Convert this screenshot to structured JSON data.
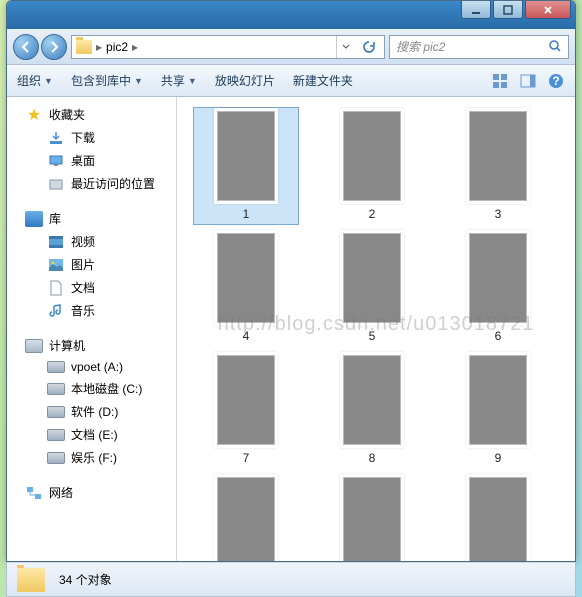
{
  "title": "",
  "path": {
    "folder": "pic2",
    "sep": "▸"
  },
  "search": {
    "placeholder": "搜索 pic2"
  },
  "toolbar": {
    "organize": "组织",
    "include": "包含到库中",
    "share": "共享",
    "slideshow": "放映幻灯片",
    "newfolder": "新建文件夹"
  },
  "sidebar": {
    "favorites": "收藏夹",
    "downloads": "下载",
    "desktop": "桌面",
    "recent": "最近访问的位置",
    "libraries": "库",
    "videos": "视频",
    "pictures": "图片",
    "documents": "文档",
    "music": "音乐",
    "computer": "计算机",
    "drives": [
      {
        "label": "vpoet (A:)"
      },
      {
        "label": "本地磁盘 (C:)"
      },
      {
        "label": "软件 (D:)"
      },
      {
        "label": "文档 (E:)"
      },
      {
        "label": "娱乐 (F:)"
      }
    ],
    "network": "网络"
  },
  "items": [
    {
      "label": "1",
      "cls": "p1",
      "selected": true
    },
    {
      "label": "2",
      "cls": "p2"
    },
    {
      "label": "3",
      "cls": "p3"
    },
    {
      "label": "4",
      "cls": "p4"
    },
    {
      "label": "5",
      "cls": "p5"
    },
    {
      "label": "6",
      "cls": "p6"
    },
    {
      "label": "7",
      "cls": "p7"
    },
    {
      "label": "8",
      "cls": "p8"
    },
    {
      "label": "9",
      "cls": "p9"
    },
    {
      "label": "",
      "cls": "p10"
    },
    {
      "label": "",
      "cls": "p11"
    },
    {
      "label": "",
      "cls": "p12"
    }
  ],
  "status": {
    "count": "34 个对象"
  },
  "watermark": "http://blog.csdn.net/u013018721"
}
